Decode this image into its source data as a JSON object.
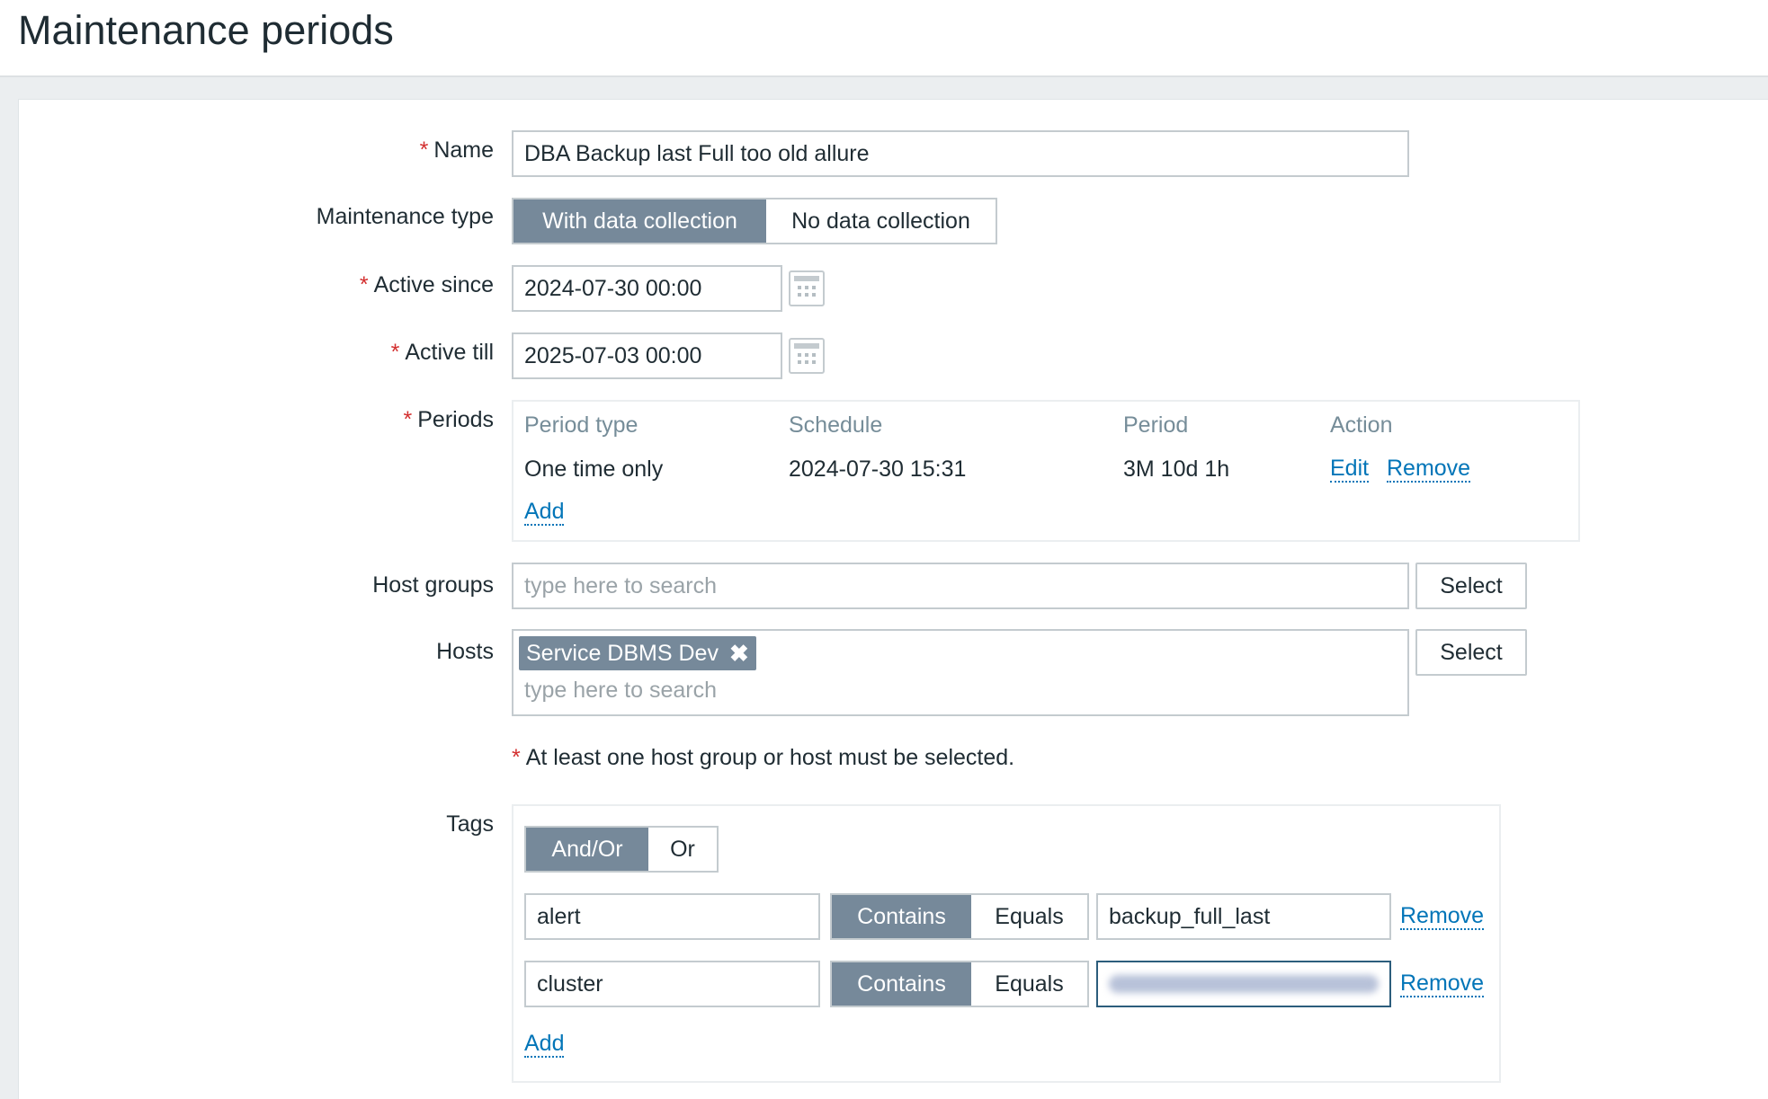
{
  "page": {
    "title": "Maintenance periods"
  },
  "form": {
    "name": {
      "label": "Name",
      "value": "DBA Backup last Full too old allure"
    },
    "maintenance_type": {
      "label": "Maintenance type",
      "options": [
        "With data collection",
        "No data collection"
      ],
      "selected": "With data collection"
    },
    "active_since": {
      "label": "Active since",
      "value": "2024-07-30 00:00"
    },
    "active_till": {
      "label": "Active till",
      "value": "2025-07-03 00:00"
    },
    "periods": {
      "label": "Periods",
      "headers": [
        "Period type",
        "Schedule",
        "Period",
        "Action"
      ],
      "rows": [
        {
          "type": "One time only",
          "schedule": "2024-07-30 15:31",
          "period": "3M 10d 1h",
          "edit": "Edit",
          "remove": "Remove"
        }
      ],
      "add": "Add"
    },
    "host_groups": {
      "label": "Host groups",
      "placeholder": "type here to search",
      "select": "Select"
    },
    "hosts": {
      "label": "Hosts",
      "chips": [
        "Service DBMS Dev"
      ],
      "placeholder": "type here to search",
      "select": "Select"
    },
    "hint": "At least one host group or host must be selected.",
    "tags": {
      "label": "Tags",
      "eval_options": [
        "And/Or",
        "Or"
      ],
      "eval_selected": "And/Or",
      "rows": [
        {
          "tag": "alert",
          "operators": [
            "Contains",
            "Equals"
          ],
          "operator": "Contains",
          "value": "backup_full_last",
          "remove": "Remove"
        },
        {
          "tag": "cluster",
          "operators": [
            "Contains",
            "Equals"
          ],
          "operator": "Contains",
          "value": "",
          "remove": "Remove"
        }
      ],
      "add": "Add"
    }
  },
  "colors": {
    "accent": "#76899a",
    "link": "#0275b8",
    "required": "#d32f2f"
  }
}
